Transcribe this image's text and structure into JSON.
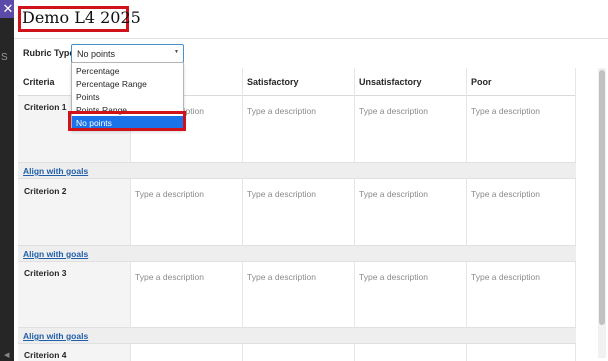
{
  "window": {
    "close_glyph": "✕",
    "edge_letter": "S",
    "edge_arrow": "◀"
  },
  "header": {
    "title": "Demo L4 2025"
  },
  "rubric_type": {
    "label": "Rubric Type:",
    "selected_value": "No points",
    "options": [
      "Percentage",
      "Percentage Range",
      "Points",
      "Points Range",
      "No points"
    ]
  },
  "columns": [
    "Criteria",
    "",
    "Satisfactory",
    "Unsatisfactory",
    "Poor"
  ],
  "criteria": [
    {
      "name": "Criterion 1",
      "descriptions": [
        "Type a description",
        "Type a description",
        "Type a description",
        "Type a description"
      ],
      "align_label": "Align with goals"
    },
    {
      "name": "Criterion 2",
      "descriptions": [
        "Type a description",
        "Type a description",
        "Type a description",
        "Type a description"
      ],
      "align_label": "Align with goals"
    },
    {
      "name": "Criterion 3",
      "descriptions": [
        "Type a description",
        "Type a description",
        "Type a description",
        "Type a description"
      ],
      "align_label": "Align with goals"
    },
    {
      "name": "Criterion 4"
    }
  ],
  "colors": {
    "accent": "#1a73e8",
    "annotation": "#d0121b",
    "close_button": "#5b4aa8"
  }
}
